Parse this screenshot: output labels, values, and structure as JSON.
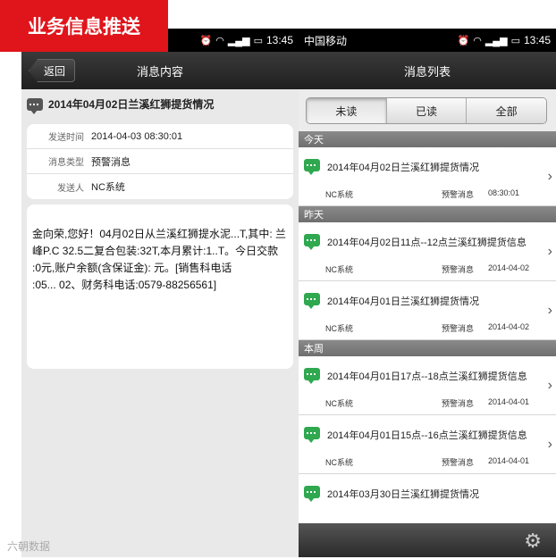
{
  "brand": "业务信息推送",
  "left": {
    "status": {
      "carrier": "",
      "time": "13:45"
    },
    "back_label": "返回",
    "title": "消息内容",
    "msg_title": "2014年04月02日兰溪红狮提货情况",
    "info": [
      {
        "key": "发送时间",
        "value": "2014-04-03 08:30:01"
      },
      {
        "key": "消息类型",
        "value": "预警消息"
      },
      {
        "key": "发送人",
        "value": "NC系统"
      }
    ],
    "body_lines": [
      "金向荣,您好！04月02日从兰溪红狮提水泥...T,其中: 兰",
      "峰P.C 32.5二复合包装:32T,本月累计:1..T。今日交款",
      ":0元,账户余额(含保证金):        元。[销售科电话",
      ":05...           02、财务科电话:0579-88256561]"
    ]
  },
  "right": {
    "status": {
      "carrier": "中国移动",
      "time": "13:45"
    },
    "title": "消息列表",
    "tabs": [
      "未读",
      "已读",
      "全部"
    ],
    "sections": [
      {
        "label": "今天",
        "items": [
          {
            "title": "2014年04月02日兰溪红狮提货情况",
            "sender": "NC系统",
            "type": "预警消息",
            "time": "08:30:01"
          }
        ]
      },
      {
        "label": "昨天",
        "items": [
          {
            "title": "2014年04月02日11点--12点兰溪红狮提货信息",
            "sender": "NC系统",
            "type": "预警消息",
            "time": "2014-04-02"
          },
          {
            "title": "2014年04月01日兰溪红狮提货情况",
            "sender": "NC系统",
            "type": "预警消息",
            "time": "2014-04-02"
          }
        ]
      },
      {
        "label": "本周",
        "items": [
          {
            "title": "2014年04月01日17点--18点兰溪红狮提货信息",
            "sender": "NC系统",
            "type": "预警消息",
            "time": "2014-04-01"
          },
          {
            "title": "2014年04月01日15点--16点兰溪红狮提货信息",
            "sender": "NC系统",
            "type": "预警消息",
            "time": "2014-04-01"
          },
          {
            "title": "2014年03月30日兰溪红狮提货情况",
            "sender": "",
            "type": "",
            "time": ""
          }
        ]
      }
    ]
  },
  "watermark": "六朝数据",
  "colors": {
    "brand": "#e0141b",
    "message_icon": "#2fa84f"
  }
}
